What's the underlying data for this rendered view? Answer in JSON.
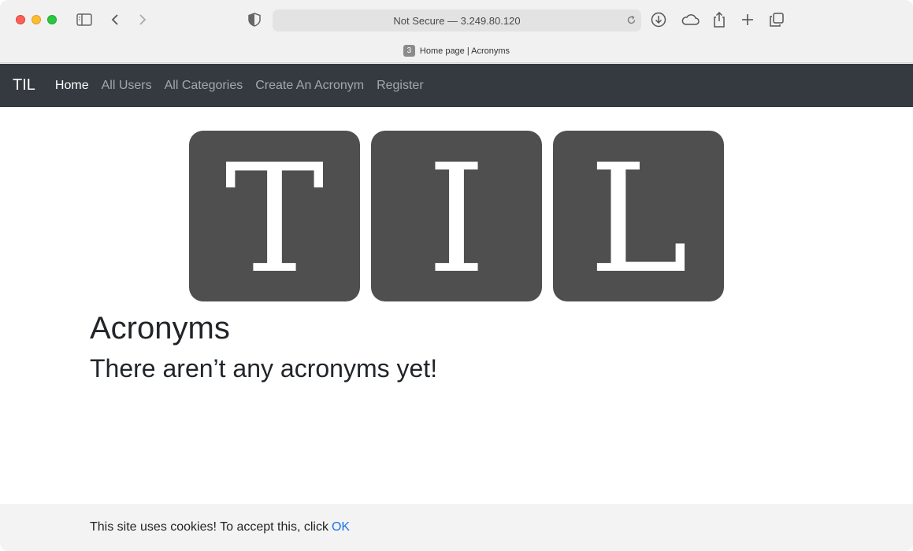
{
  "browser": {
    "address": "Not Secure — 3.249.80.120",
    "tab_count": "3",
    "tab_title": "Home page | Acronyms"
  },
  "navbar": {
    "brand": "TIL",
    "links": [
      {
        "label": "Home",
        "active": true
      },
      {
        "label": "All Users"
      },
      {
        "label": "All Categories"
      },
      {
        "label": "Create An Acronym"
      },
      {
        "label": "Register"
      }
    ]
  },
  "logo": {
    "letters": [
      "T",
      "I",
      "L"
    ],
    "tile_color": "#4f4f4f"
  },
  "main": {
    "heading": "Acronyms",
    "empty_message": "There aren’t any acronyms yet!"
  },
  "cookie": {
    "message": "This site uses cookies! To accept this, click",
    "accept_label": "OK"
  },
  "colors": {
    "navbar_bg": "#343a40",
    "link_accent": "#1a73e8"
  }
}
